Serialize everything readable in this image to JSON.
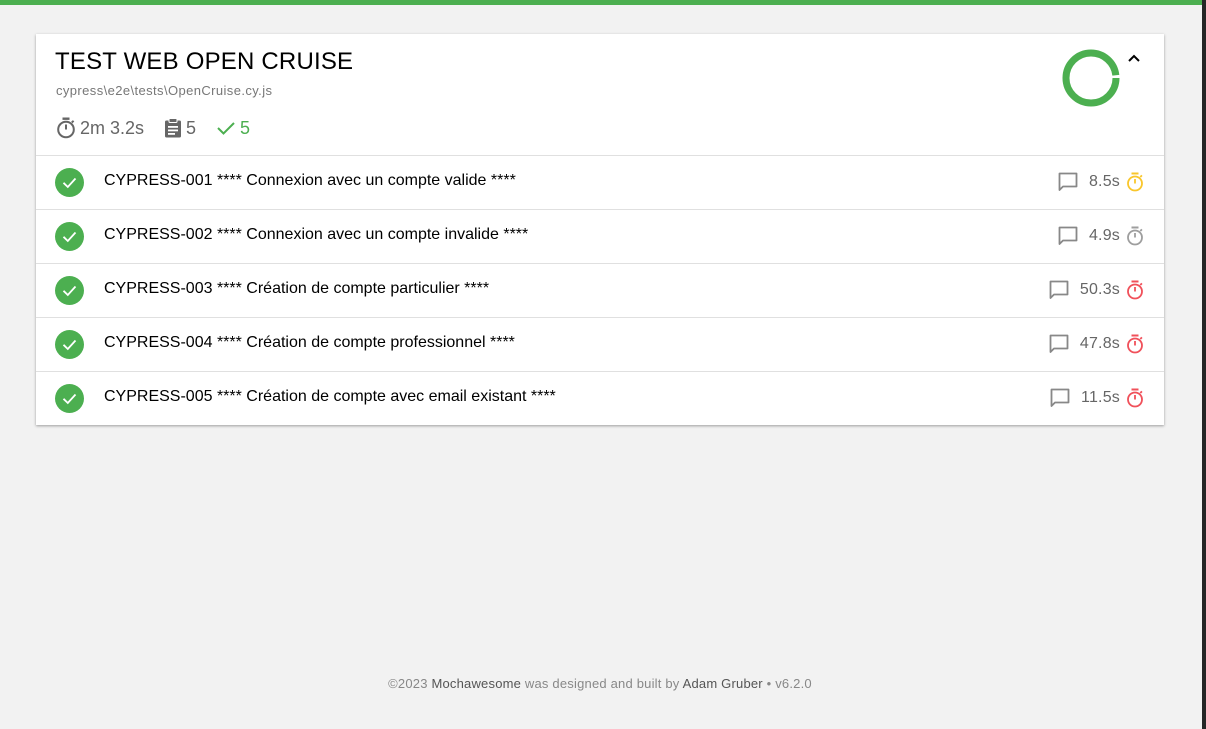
{
  "suite": {
    "title": "TEST WEB OPEN CRUISE",
    "file": "cypress\\e2e\\tests\\OpenCruise.cy.js",
    "duration": "2m 3.2s",
    "tests_count": "5",
    "passed_count": "5",
    "pass_percent": 100
  },
  "tests": [
    {
      "title": "CYPRESS-001 **** Connexion avec un compte valide ****",
      "duration": "8.5s",
      "speed": "medium"
    },
    {
      "title": "CYPRESS-002 **** Connexion avec un compte invalide ****",
      "duration": "4.9s",
      "speed": "fast"
    },
    {
      "title": "CYPRESS-003 **** Création de compte particulier ****",
      "duration": "50.3s",
      "speed": "slow"
    },
    {
      "title": "CYPRESS-004 **** Création de compte professionnel ****",
      "duration": "47.8s",
      "speed": "slow"
    },
    {
      "title": "CYPRESS-005 **** Création de compte avec email existant ****",
      "duration": "11.5s",
      "speed": "slow"
    }
  ],
  "footer": {
    "copyright": "©2023 ",
    "brand": "Mochawesome",
    "middle": " was designed and built by ",
    "author": "Adam Gruber",
    "version": " • v6.2.0"
  },
  "colors": {
    "pass": "#4caf50",
    "fast": "#9e9e9e",
    "medium": "#f9c62b",
    "slow": "#f0505a"
  },
  "icons": {
    "duration": "stopwatch-icon",
    "tests": "clipboard-icon",
    "passed": "check-icon",
    "comment": "comment-icon",
    "collapse": "chevron-up-icon",
    "status": "check-circle-icon"
  }
}
